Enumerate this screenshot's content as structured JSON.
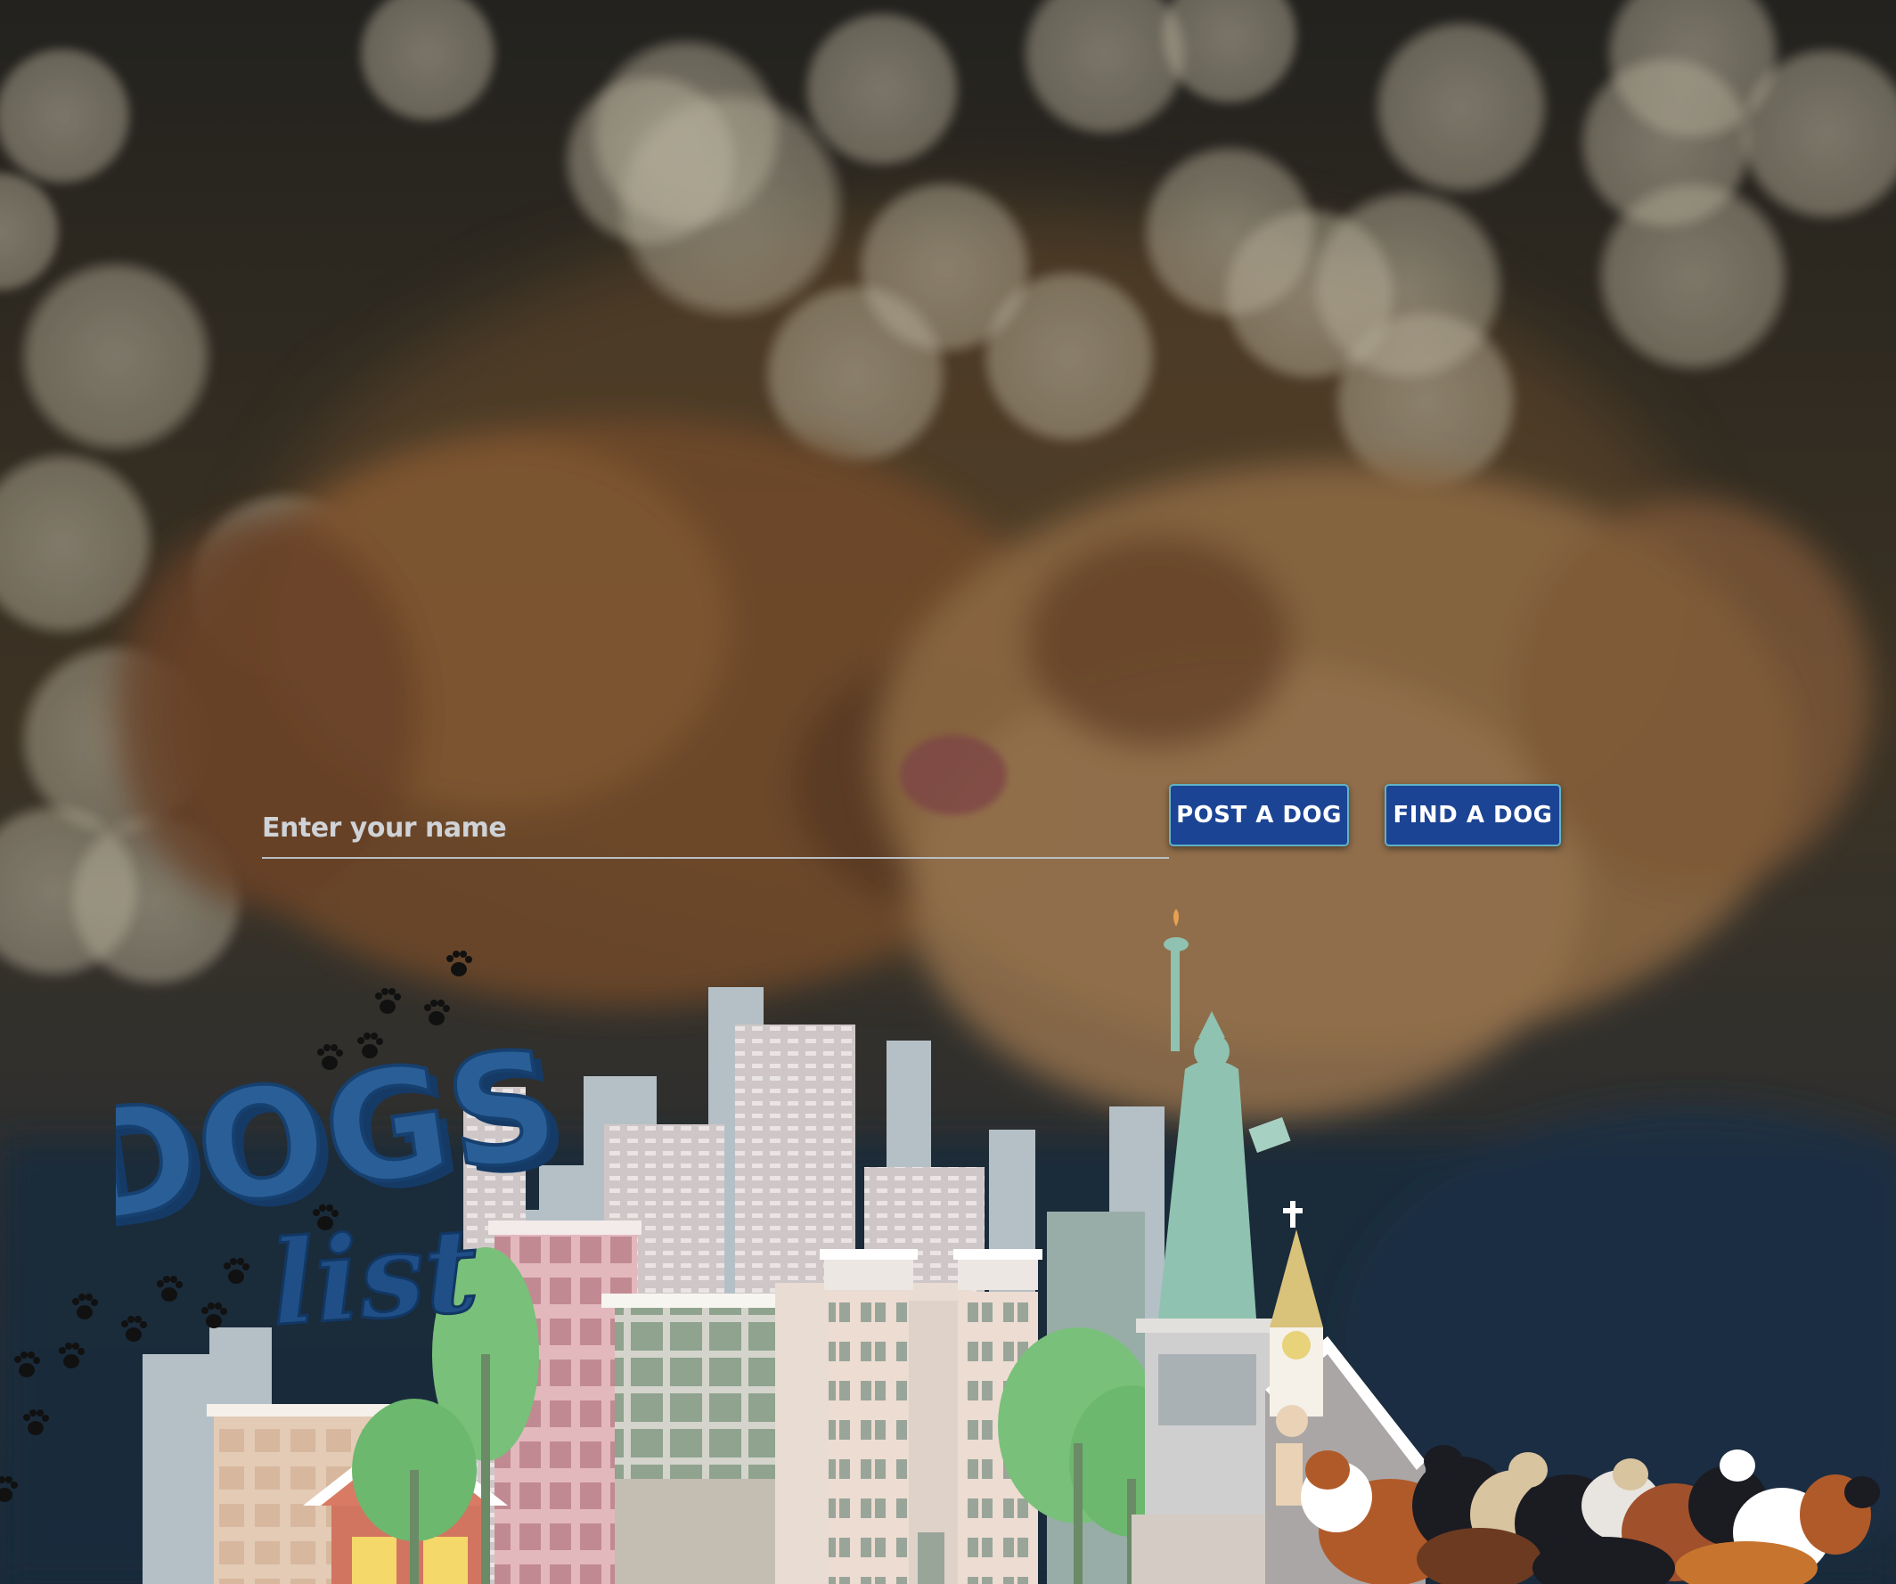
{
  "form": {
    "name_placeholder": "Enter your name",
    "name_value": "",
    "post_button_label": "POST A DOG",
    "find_button_label": "FIND A DOG"
  },
  "logo": {
    "line1": "DOGS",
    "line2": "LIST"
  },
  "colors": {
    "button_bg": "#1c4494",
    "button_border": "#5fb3c6",
    "logo_blue": "#1f4f86",
    "tree_green": "#79c07a",
    "liberty_green": "#8fc2b0"
  },
  "icons": {
    "paw": "paw-print-icon",
    "cross": "church-cross-icon"
  }
}
